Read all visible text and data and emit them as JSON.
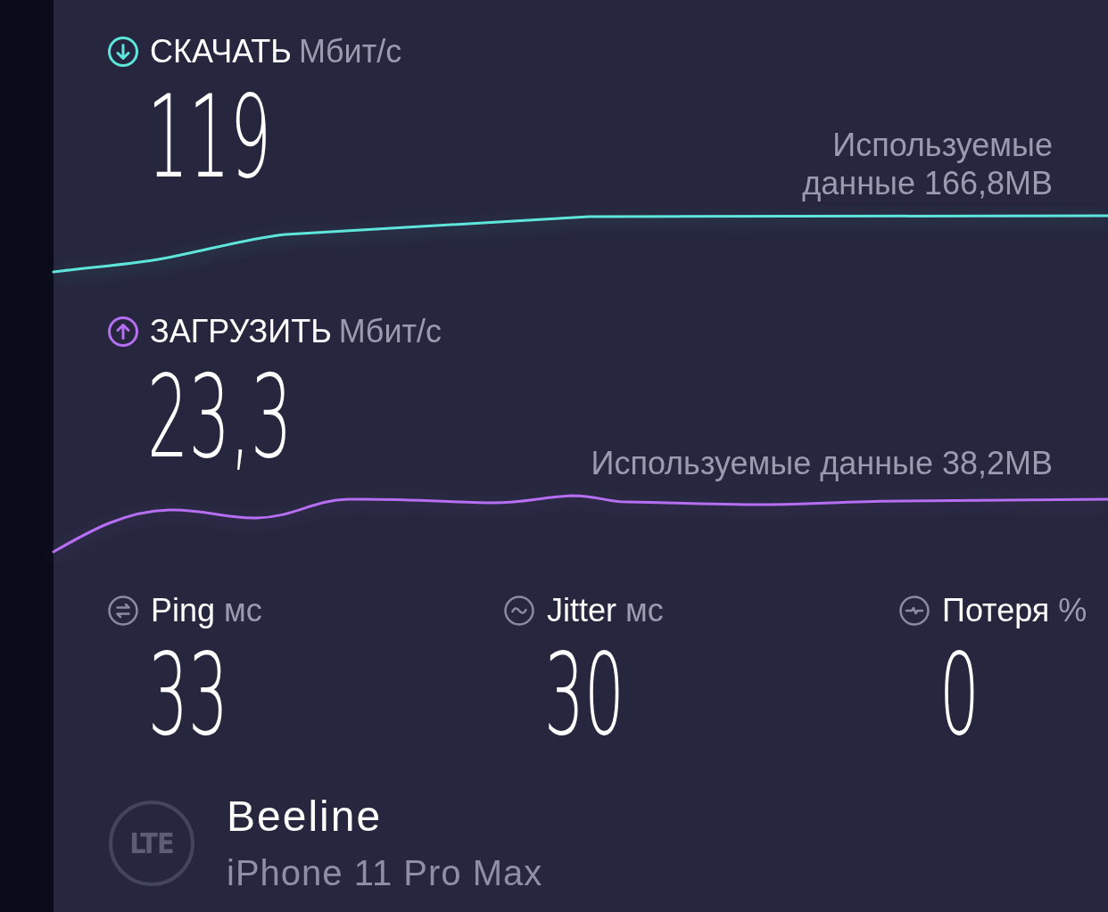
{
  "speed_tests": [
    {
      "kind": "download",
      "color": "#5ee6dc",
      "label": "СКАЧАТЬ",
      "unit": "Мбит/с",
      "value": "119",
      "data_used": "Используемые данные 166,8MB"
    },
    {
      "kind": "upload",
      "color": "#b66ef2",
      "label": "ЗАГРУЗИТЬ",
      "unit": "Мбит/с",
      "value": "23,3",
      "data_used": "Используемые данные 38,2MB"
    }
  ],
  "metrics": [
    {
      "kind": "ping",
      "label": "Ping",
      "unit": "мс",
      "value": "33"
    },
    {
      "kind": "jitter",
      "label": "Jitter",
      "unit": "мс",
      "value": "30"
    },
    {
      "kind": "loss",
      "label": "Потеря",
      "unit": "%",
      "value": "0"
    }
  ],
  "connection": {
    "network_type": "LTE",
    "carrier": "Beeline",
    "device": "iPhone 11 Pro Max"
  }
}
